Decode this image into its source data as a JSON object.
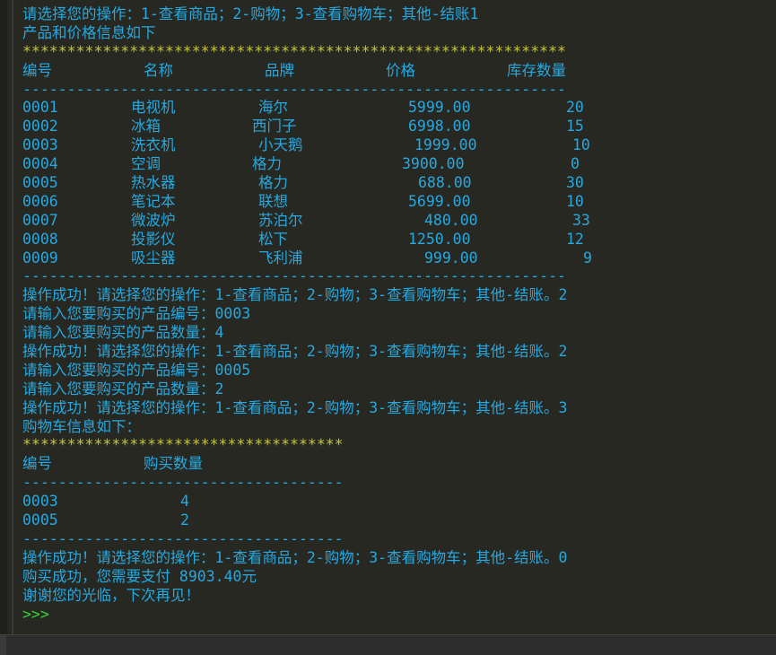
{
  "console": {
    "intro_prompt": "请选择您的操作：1-查看商品；2-购物；3-查看购物车；其他-结账1",
    "product_info_title": "产品和价格信息如下",
    "stars_long": "*************************************************************",
    "product_headers": [
      "编号",
      "名称",
      "品牌",
      "价格",
      "库存数量"
    ],
    "dash_long": "-------------------------------------------------------------",
    "products": [
      {
        "id": "0001",
        "name": "电视机",
        "brand": "海尔",
        "price": "5999.00",
        "stock": "20"
      },
      {
        "id": "0002",
        "name": "冰箱",
        "brand": "西门子",
        "price": "6998.00",
        "stock": "15"
      },
      {
        "id": "0003",
        "name": "洗衣机",
        "brand": "小天鹅",
        "price": "1999.00",
        "stock": "10"
      },
      {
        "id": "0004",
        "name": "空调",
        "brand": "格力",
        "price": "3900.00",
        "stock": "0"
      },
      {
        "id": "0005",
        "name": "热水器",
        "brand": "格力",
        "price": "688.00",
        "stock": "30"
      },
      {
        "id": "0006",
        "name": "笔记本",
        "brand": "联想",
        "price": "5699.00",
        "stock": "10"
      },
      {
        "id": "0007",
        "name": "微波炉",
        "brand": "苏泊尔",
        "price": "480.00",
        "stock": "33"
      },
      {
        "id": "0008",
        "name": "投影仪",
        "brand": "松下",
        "price": "1250.00",
        "stock": "12"
      },
      {
        "id": "0009",
        "name": "吸尘器",
        "brand": "飞利浦",
        "price": "999.00",
        "stock": "9"
      }
    ],
    "log": [
      "操作成功！请选择您的操作：1-查看商品；2-购物；3-查看购物车；其他-结账。2",
      "请输入您要购买的产品编号：0003",
      "请输入您要购买的产品数量：4",
      "操作成功！请选择您的操作：1-查看商品；2-购物；3-查看购物车；其他-结账。2",
      "请输入您要购买的产品编号：0005",
      "请输入您要购买的产品数量：2",
      "操作成功！请选择您的操作：1-查看商品；2-购物；3-查看购物车；其他-结账。3"
    ],
    "cart_title": "购物车信息如下：",
    "stars_short": "************************************",
    "cart_headers": [
      "编号",
      "购买数量"
    ],
    "dash_short": "------------------------------------",
    "cart_items": [
      {
        "id": "0003",
        "qty": "4"
      },
      {
        "id": "0005",
        "qty": "2"
      }
    ],
    "final_op": "操作成功！请选择您的操作：1-查看商品；2-购物；3-查看购物车；其他-结账。0",
    "payment": "购买成功，您需要支付 8903.40元",
    "farewell": "谢谢您的光临，下次再见！",
    "prompt": ">>>"
  },
  "colors": {
    "background": "#272822",
    "text": "#27a8e0",
    "stars": "#c6c63a",
    "prompt": "#38d13a"
  }
}
